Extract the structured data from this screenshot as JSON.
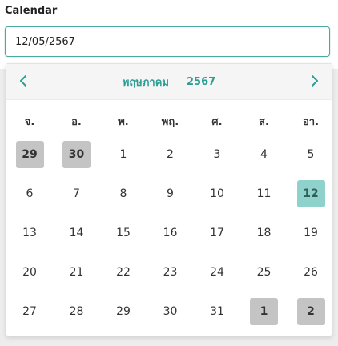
{
  "field": {
    "label": "Calendar",
    "value": "12/05/2567"
  },
  "calendar": {
    "month_label": "พฤษภาคม",
    "year_label": "2567",
    "weekdays": [
      "จ.",
      "อ.",
      "พ.",
      "พฤ.",
      "ศ.",
      "ส.",
      "อา."
    ],
    "weeks": [
      [
        {
          "d": "29",
          "o": true
        },
        {
          "d": "30",
          "o": true
        },
        {
          "d": "1"
        },
        {
          "d": "2"
        },
        {
          "d": "3"
        },
        {
          "d": "4"
        },
        {
          "d": "5"
        }
      ],
      [
        {
          "d": "6"
        },
        {
          "d": "7"
        },
        {
          "d": "8"
        },
        {
          "d": "9"
        },
        {
          "d": "10"
        },
        {
          "d": "11"
        },
        {
          "d": "12",
          "s": true
        }
      ],
      [
        {
          "d": "13"
        },
        {
          "d": "14"
        },
        {
          "d": "15"
        },
        {
          "d": "16"
        },
        {
          "d": "17"
        },
        {
          "d": "18"
        },
        {
          "d": "19"
        }
      ],
      [
        {
          "d": "20"
        },
        {
          "d": "21"
        },
        {
          "d": "22"
        },
        {
          "d": "23"
        },
        {
          "d": "24"
        },
        {
          "d": "25"
        },
        {
          "d": "26"
        }
      ],
      [
        {
          "d": "27"
        },
        {
          "d": "28"
        },
        {
          "d": "29"
        },
        {
          "d": "30"
        },
        {
          "d": "31"
        },
        {
          "d": "1",
          "o": true
        },
        {
          "d": "2",
          "o": true
        }
      ]
    ]
  },
  "icons": {
    "prev": "chevron-left-icon",
    "next": "chevron-right-icon"
  },
  "colors": {
    "accent": "#2e9e95",
    "selected_bg": "#8fd2cb",
    "other_month_bg": "#c4c4c4",
    "input_border": "#4aa9a1"
  }
}
